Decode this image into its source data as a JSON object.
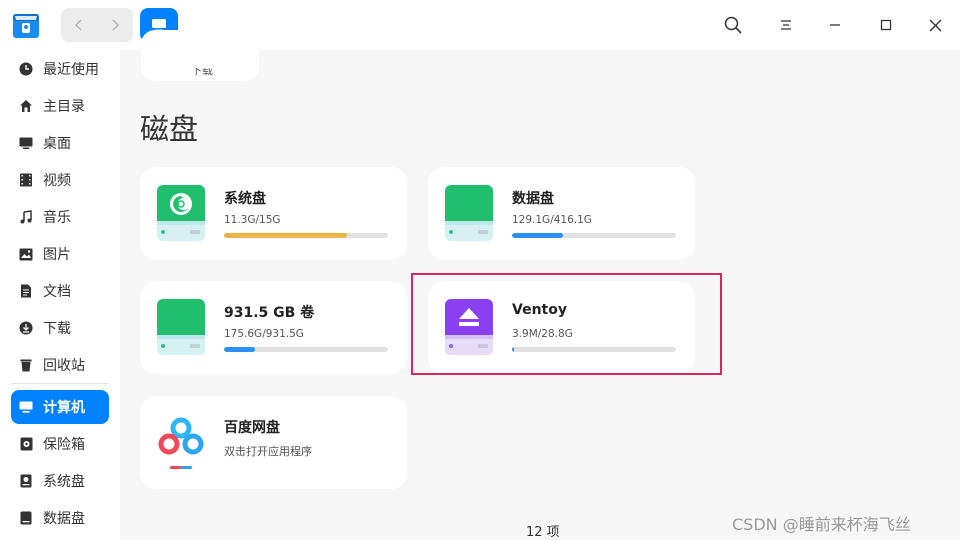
{
  "titlebar": {
    "app_icon": "file-manager-icon",
    "back_icon": "chevron-left-icon",
    "forward_icon": "chevron-right-icon",
    "crumb_icon": "computer-icon",
    "search_icon": "search-icon",
    "menu_icon": "menu-icon",
    "minimize_icon": "minimize-icon",
    "maximize_icon": "maximize-icon",
    "close_icon": "close-icon"
  },
  "sidebar": {
    "items": [
      {
        "label": "最近使用",
        "icon": "clock-icon"
      },
      {
        "label": "主目录",
        "icon": "home-icon"
      },
      {
        "label": "桌面",
        "icon": "desktop-icon"
      },
      {
        "label": "视频",
        "icon": "video-icon"
      },
      {
        "label": "音乐",
        "icon": "music-icon"
      },
      {
        "label": "图片",
        "icon": "picture-icon"
      },
      {
        "label": "文档",
        "icon": "document-icon"
      },
      {
        "label": "下载",
        "icon": "download-icon"
      },
      {
        "label": "回收站",
        "icon": "trash-icon"
      },
      {
        "label": "计算机",
        "icon": "computer-icon",
        "active": true
      },
      {
        "label": "保险箱",
        "icon": "vault-icon"
      },
      {
        "label": "系统盘",
        "icon": "drive-icon"
      },
      {
        "label": "数据盘",
        "icon": "drive-icon"
      }
    ]
  },
  "main": {
    "partial_card_label": "下载",
    "section_title": "磁盘",
    "disks": [
      {
        "name": "系统盘",
        "size": "11.3G/15G",
        "usage": 0.753,
        "bar_color": "#f0b44c",
        "icon": "deepin-system-drive-icon"
      },
      {
        "name": "数据盘",
        "size": "129.1G/416.1G",
        "usage": 0.31,
        "bar_color": "#2b8ff3",
        "icon": "green-drive-icon"
      },
      {
        "name": "931.5 GB 卷",
        "size": "175.6G/931.5G",
        "usage": 0.189,
        "bar_color": "#2b8ff3",
        "icon": "green-drive-icon"
      },
      {
        "name": "Ventoy",
        "size": "3.9M/28.8G",
        "usage": 0.012,
        "bar_color": "#2b8ff3",
        "icon": "removable-drive-icon"
      }
    ],
    "cloud": {
      "name": "百度网盘",
      "desc": "双击打开应用程序",
      "icon": "baidu-netdisk-icon"
    },
    "status": "12 项"
  },
  "watermark": "CSDN @睡前来杯海飞丝",
  "colors": {
    "accent": "#0081ff",
    "highlight": "#e0245e",
    "drive_green": "#1fbf6e",
    "ventoy_purple": "#8a3ff0"
  }
}
